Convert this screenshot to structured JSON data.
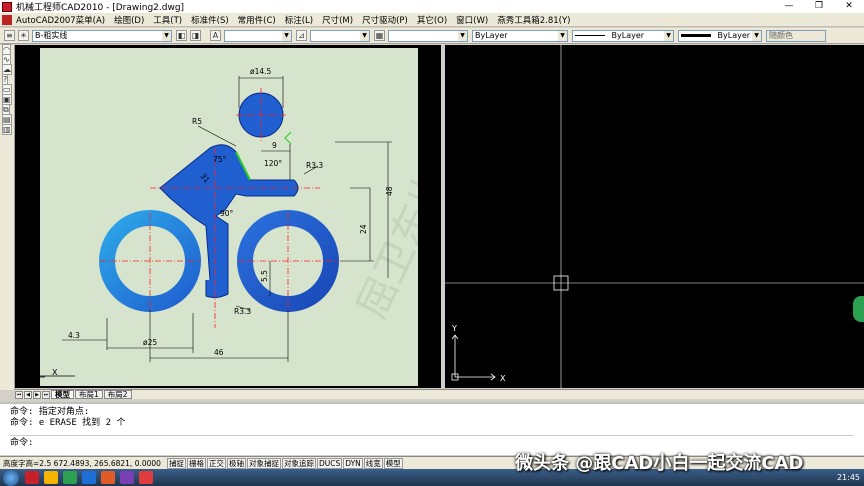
{
  "window": {
    "title": "机械工程师CAD2010 - [Drawing2.dwg]",
    "controls": [
      "—",
      "❐",
      "✕"
    ]
  },
  "menu": [
    "AutoCAD2007菜单(A)",
    "绘图(D)",
    "工具(T)",
    "标准件(S)",
    "常用件(C)",
    "标注(L)",
    "尺寸(M)",
    "尺寸驱动(P)",
    "其它(O)",
    "窗口(W)",
    "燕秀工具箱2.81(Y)"
  ],
  "toolbar": {
    "layer_value": "B-粗实线",
    "color_value": "ByLayer",
    "linetype_value": "ByLayer",
    "lineweight_value": "ByLayer",
    "plotstyle_value": "随颜色"
  },
  "drawing": {
    "dims": {
      "d14_5": "ø14.5",
      "r5": "R5",
      "d9": "9",
      "a75": "75°",
      "a120": "120°",
      "r3_3a": "R3.3",
      "d48": "48",
      "d31": "31",
      "a90": "90°",
      "d24": "24",
      "d5_5": "5.5",
      "r3_3b": "R3.3",
      "d4_3": "4.3",
      "d25": "ø25",
      "d46": "46"
    },
    "watermark": "屈卫东出品"
  },
  "ucs": {
    "x": "X",
    "y": "Y"
  },
  "layout_tabs": [
    "模型",
    "布局1",
    "布局2"
  ],
  "nav_glyphs": [
    "⏮",
    "◀",
    "▶",
    "⏭"
  ],
  "command": {
    "lines": [
      "命令: 指定对角点:",
      "命令: e ERASE 找到 2 个"
    ],
    "prompt": "命令:"
  },
  "status": {
    "coords": "高度字高=2.5  672.4893, 265.6821, 0.0000",
    "buttons": [
      "捕捉",
      "栅格",
      "正交",
      "极轴",
      "对象捕捉",
      "对象追踪",
      "DUCS",
      "DYN",
      "线宽",
      "模型"
    ]
  },
  "overlay": {
    "watermark_text": "微头条 @跟CAD小白一起交流CAD"
  },
  "taskbar": {
    "clock": "21:45",
    "icon_colors": [
      "#c8202a",
      "#f4b400",
      "#2aa050",
      "#1d6fd6",
      "#e15b26",
      "#7b3fb5",
      "#e23b3b"
    ]
  },
  "colors": {
    "accent_blue": "#1f5fd0",
    "light_blue": "#2da7e8",
    "centerline": "#ff2020",
    "dimension": "#000000"
  }
}
